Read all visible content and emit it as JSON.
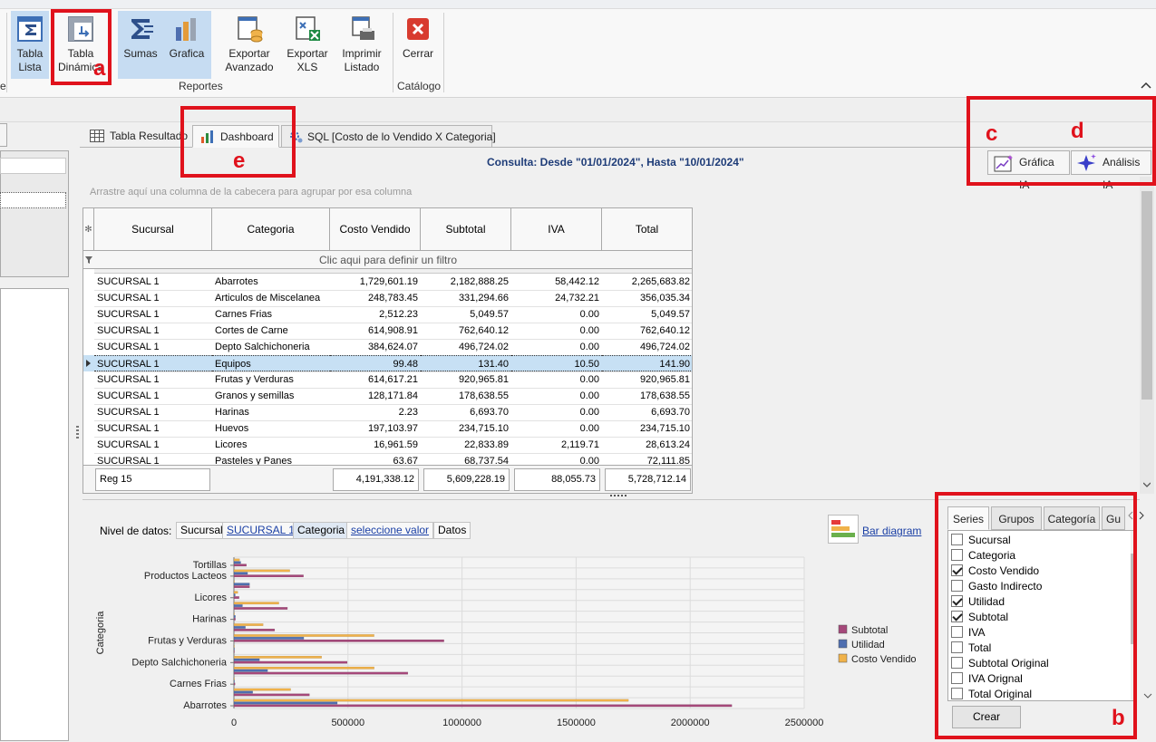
{
  "ribbon": {
    "tabla_lista": "Tabla\nLista",
    "tabla_dinamica": "Tabla\nDinámica",
    "sumas": "Sumas",
    "grafica": "Grafica",
    "exportar_avanzado": "Exportar\nAvanzado",
    "exportar_xls": "Exportar\nXLS",
    "imprimir_listado": "Imprimir\nListado",
    "cerrar": "Cerrar",
    "group_reportes": "Reportes",
    "group_catalogo": "Catálogo",
    "group_left_partial": "e"
  },
  "annotations": {
    "a": "a",
    "b": "b",
    "c": "c",
    "d": "d",
    "e": "e"
  },
  "tabs": {
    "tabla_resultado": "Tabla Resultado",
    "dashboard": "Dashboard",
    "sql": "SQL [Costo de lo Vendido X Categoria]"
  },
  "consulta": "Consulta:  Desde \"01/01/2024\", Hasta \"10/01/2024\"",
  "ai_buttons": {
    "grafica_ia": "Gráfica IA",
    "analisis_ia": "Análisis IA"
  },
  "group_hint": "Arrastre aquí una columna de la cabecera para agrupar por esa columna",
  "grid": {
    "row_indicator_header": "✻",
    "columns": [
      "Sucursal",
      "Categoria",
      "Costo Vendido",
      "Subtotal",
      "IVA",
      "Total"
    ],
    "filter_text": "Clic aqui para definir un filtro",
    "rows": [
      [
        "SUCURSAL 1",
        "Abarrotes",
        "1,729,601.19",
        "2,182,888.25",
        "58,442.12",
        "2,265,683.82"
      ],
      [
        "SUCURSAL 1",
        "Articulos de Miscelanea",
        "248,783.45",
        "331,294.66",
        "24,732.21",
        "356,035.34"
      ],
      [
        "SUCURSAL 1",
        "Carnes Frias",
        "2,512.23",
        "5,049.57",
        "0.00",
        "5,049.57"
      ],
      [
        "SUCURSAL 1",
        "Cortes de Carne",
        "614,908.91",
        "762,640.12",
        "0.00",
        "762,640.12"
      ],
      [
        "SUCURSAL 1",
        "Depto Salchichoneria",
        "384,624.07",
        "496,724.02",
        "0.00",
        "496,724.02"
      ],
      [
        "SUCURSAL 1",
        "Equipos",
        "99.48",
        "131.40",
        "10.50",
        "141.90"
      ],
      [
        "SUCURSAL 1",
        "Frutas y Verduras",
        "614,617.21",
        "920,965.81",
        "0.00",
        "920,965.81"
      ],
      [
        "SUCURSAL 1",
        "Granos y semillas",
        "128,171.84",
        "178,638.55",
        "0.00",
        "178,638.55"
      ],
      [
        "SUCURSAL 1",
        "Harinas",
        "2.23",
        "6,693.70",
        "0.00",
        "6,693.70"
      ],
      [
        "SUCURSAL 1",
        "Huevos",
        "197,103.97",
        "234,715.10",
        "0.00",
        "234,715.10"
      ],
      [
        "SUCURSAL 1",
        "Licores",
        "16,961.59",
        "22,833.89",
        "2,119.71",
        "28,613.24"
      ],
      [
        "SUCURSAL 1",
        "Pasteles y Panes",
        "63.67",
        "68,737.54",
        "0.00",
        "72,111.85"
      ]
    ],
    "selected_row": 5,
    "footer": {
      "reg": "Reg 15",
      "costo": "4,191,338.12",
      "subtotal": "5,609,228.19",
      "iva": "88,055.73",
      "total": "5,728,712.14"
    }
  },
  "nivel": {
    "label": "Nivel de datos:",
    "chips": [
      "Sucursal",
      "SUCURSAL 1",
      "Categoria",
      "seleccione valor",
      "Datos"
    ]
  },
  "bar_diagram": "Bar diagram",
  "chart_data": {
    "type": "bar",
    "orientation": "horizontal",
    "ylabel": "Categoria",
    "xlabel": "",
    "xlim": [
      0,
      2500000
    ],
    "x_ticks": [
      "0",
      "500000",
      "1000000",
      "1500000",
      "2000000",
      "2500000"
    ],
    "y_tick_labels": [
      "Tortillas",
      "Productos Lacteos",
      "Licores",
      "Harinas",
      "Frutas y Verduras",
      "Depto Salchichoneria",
      "Carnes Frias",
      "Abarrotes"
    ],
    "categories": [
      "Abarrotes",
      "Articulos de Miscelanea",
      "Carnes Frias",
      "Cortes de Carne",
      "Depto Salchichoneria",
      "Equipos",
      "Frutas y Verduras",
      "Granos y semillas",
      "Harinas",
      "Huevos",
      "Licores",
      "Pasteles y Panes",
      "Productos Lacteos",
      "Tortillas"
    ],
    "series": [
      {
        "name": "Subtotal",
        "color": "#a5487a",
        "values": [
          2182888,
          331295,
          5050,
          762640,
          496724,
          131,
          920966,
          178639,
          6694,
          234715,
          22834,
          68738,
          305000,
          55000
        ]
      },
      {
        "name": "Utilidad",
        "color": "#4f6fb0",
        "values": [
          453287,
          82511,
          2537,
          147731,
          112100,
          32,
          306349,
          50467,
          6691,
          37611,
          5872,
          68674,
          60000,
          30000
        ]
      },
      {
        "name": "Costo Vendido",
        "color": "#f0b24a",
        "values": [
          1729601,
          248783,
          2512,
          614909,
          384624,
          99,
          614617,
          128172,
          2,
          197104,
          16962,
          64,
          245000,
          25000
        ]
      }
    ],
    "legend_position": "right",
    "grid": true
  },
  "series_panel": {
    "tabs": [
      "Series",
      "Grupos",
      "Categoría",
      "Gu"
    ],
    "items": [
      {
        "label": "Sucursal",
        "checked": false
      },
      {
        "label": "Categoria",
        "checked": false
      },
      {
        "label": "Costo Vendido",
        "checked": true
      },
      {
        "label": "Gasto Indirecto",
        "checked": false
      },
      {
        "label": "Utilidad",
        "checked": true
      },
      {
        "label": "Subtotal",
        "checked": true
      },
      {
        "label": "IVA",
        "checked": false
      },
      {
        "label": "Total",
        "checked": false
      },
      {
        "label": "Subtotal Original",
        "checked": false
      },
      {
        "label": "IVA Orignal",
        "checked": false
      },
      {
        "label": "Total Original",
        "checked": false
      }
    ],
    "crear": "Crear"
  }
}
